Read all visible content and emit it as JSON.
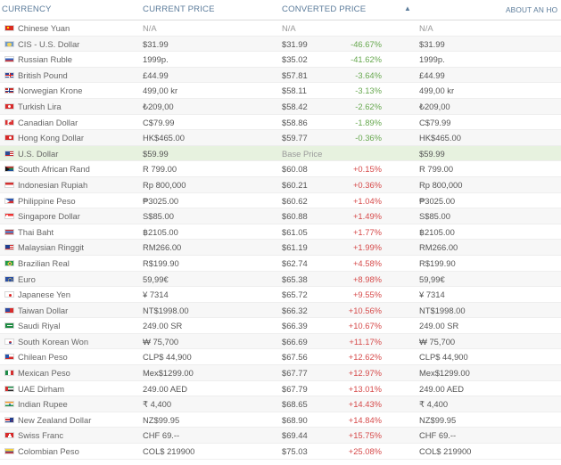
{
  "table": {
    "headers": {
      "currency": "CURRENCY",
      "current_price": "CURRENT PRICE",
      "converted_price": "CONVERTED PRICE",
      "sort_icon": "▲",
      "about": "ABOUT AN HO"
    },
    "rows": [
      {
        "flag_icon": "china-flag-icon",
        "name": "Chinese Yuan",
        "current": "N/A",
        "converted": "N/A",
        "change": "",
        "last": "N/A",
        "change_type": "neutral"
      },
      {
        "flag_icon": "cis-flag-icon",
        "name": "CIS - U.S. Dollar",
        "current": "$31.99",
        "converted": "$31.99",
        "change": "-46.67%",
        "last": "$31.99",
        "change_type": "down"
      },
      {
        "flag_icon": "russia-flag-icon",
        "name": "Russian Ruble",
        "current": "1999p.",
        "converted": "$35.02",
        "change": "-41.62%",
        "last": "1999p.",
        "change_type": "down"
      },
      {
        "flag_icon": "uk-flag-icon",
        "name": "British Pound",
        "current": "£44.99",
        "converted": "$57.81",
        "change": "-3.64%",
        "last": "£44.99",
        "change_type": "down"
      },
      {
        "flag_icon": "norway-flag-icon",
        "name": "Norwegian Krone",
        "current": "499,00 kr",
        "converted": "$58.11",
        "change": "-3.13%",
        "last": "499,00 kr",
        "change_type": "down"
      },
      {
        "flag_icon": "turkey-flag-icon",
        "name": "Turkish Lira",
        "current": "₺209,00",
        "converted": "$58.42",
        "change": "-2.62%",
        "last": "₺209,00",
        "change_type": "down"
      },
      {
        "flag_icon": "canada-flag-icon",
        "name": "Canadian Dollar",
        "current": "C$79.99",
        "converted": "$58.86",
        "change": "-1.89%",
        "last": "C$79.99",
        "change_type": "down"
      },
      {
        "flag_icon": "hong-kong-flag-icon",
        "name": "Hong Kong Dollar",
        "current": "HK$465.00",
        "converted": "$59.77",
        "change": "-0.36%",
        "last": "HK$465.00",
        "change_type": "down"
      },
      {
        "flag_icon": "usa-flag-icon",
        "name": "U.S. Dollar",
        "current": "$59.99",
        "converted": "Base Price",
        "change": "",
        "last": "$59.99",
        "change_type": "neutral"
      },
      {
        "flag_icon": "south-africa-flag-icon",
        "name": "South African Rand",
        "current": "R 799.00",
        "converted": "$60.08",
        "change": "+0.15%",
        "last": "R 799.00",
        "change_type": "up"
      },
      {
        "flag_icon": "indonesia-flag-icon",
        "name": "Indonesian Rupiah",
        "current": "Rp 800,000",
        "converted": "$60.21",
        "change": "+0.36%",
        "last": "Rp 800,000",
        "change_type": "up"
      },
      {
        "flag_icon": "philippines-flag-icon",
        "name": "Philippine Peso",
        "current": "₱3025.00",
        "converted": "$60.62",
        "change": "+1.04%",
        "last": "₱3025.00",
        "change_type": "up"
      },
      {
        "flag_icon": "singapore-flag-icon",
        "name": "Singapore Dollar",
        "current": "S$85.00",
        "converted": "$60.88",
        "change": "+1.49%",
        "last": "S$85.00",
        "change_type": "up"
      },
      {
        "flag_icon": "thailand-flag-icon",
        "name": "Thai Baht",
        "current": "฿2105.00",
        "converted": "$61.05",
        "change": "+1.77%",
        "last": "฿2105.00",
        "change_type": "up"
      },
      {
        "flag_icon": "malaysia-flag-icon",
        "name": "Malaysian Ringgit",
        "current": "RM266.00",
        "converted": "$61.19",
        "change": "+1.99%",
        "last": "RM266.00",
        "change_type": "up"
      },
      {
        "flag_icon": "brazil-flag-icon",
        "name": "Brazilian Real",
        "current": "R$199.90",
        "converted": "$62.74",
        "change": "+4.58%",
        "last": "R$199.90",
        "change_type": "up"
      },
      {
        "flag_icon": "eu-flag-icon",
        "name": "Euro",
        "current": "59,99€",
        "converted": "$65.38",
        "change": "+8.98%",
        "last": "59,99€",
        "change_type": "up"
      },
      {
        "flag_icon": "japan-flag-icon",
        "name": "Japanese Yen",
        "current": "¥ 7314",
        "converted": "$65.72",
        "change": "+9.55%",
        "last": "¥ 7314",
        "change_type": "up"
      },
      {
        "flag_icon": "taiwan-flag-icon",
        "name": "Taiwan Dollar",
        "current": "NT$1998.00",
        "converted": "$66.32",
        "change": "+10.56%",
        "last": "NT$1998.00",
        "change_type": "up"
      },
      {
        "flag_icon": "saudi-arabia-flag-icon",
        "name": "Saudi Riyal",
        "current": "249.00 SR",
        "converted": "$66.39",
        "change": "+10.67%",
        "last": "249.00 SR",
        "change_type": "up"
      },
      {
        "flag_icon": "south-korea-flag-icon",
        "name": "South Korean Won",
        "current": "₩ 75,700",
        "converted": "$66.69",
        "change": "+11.17%",
        "last": "₩ 75,700",
        "change_type": "up"
      },
      {
        "flag_icon": "chile-flag-icon",
        "name": "Chilean Peso",
        "current": "CLP$ 44,900",
        "converted": "$67.56",
        "change": "+12.62%",
        "last": "CLP$ 44,900",
        "change_type": "up"
      },
      {
        "flag_icon": "mexico-flag-icon",
        "name": "Mexican Peso",
        "current": "Mex$1299.00",
        "converted": "$67.77",
        "change": "+12.97%",
        "last": "Mex$1299.00",
        "change_type": "up"
      },
      {
        "flag_icon": "uae-flag-icon",
        "name": "UAE Dirham",
        "current": "249.00 AED",
        "converted": "$67.79",
        "change": "+13.01%",
        "last": "249.00 AED",
        "change_type": "up"
      },
      {
        "flag_icon": "india-flag-icon",
        "name": "Indian Rupee",
        "current": "₹ 4,400",
        "converted": "$68.65",
        "change": "+14.43%",
        "last": "₹ 4,400",
        "change_type": "up"
      },
      {
        "flag_icon": "new-zealand-flag-icon",
        "name": "New Zealand Dollar",
        "current": "NZ$99.95",
        "converted": "$68.90",
        "change": "+14.84%",
        "last": "NZ$99.95",
        "change_type": "up"
      },
      {
        "flag_icon": "switzerland-flag-icon",
        "name": "Swiss Franc",
        "current": "CHF 69.--",
        "converted": "$69.44",
        "change": "+15.75%",
        "last": "CHF 69.--",
        "change_type": "up"
      },
      {
        "flag_icon": "colombia-flag-icon",
        "name": "Colombian Peso",
        "current": "COL$ 219900",
        "converted": "$75.03",
        "change": "+25.08%",
        "last": "COL$ 219900",
        "change_type": "up"
      }
    ]
  },
  "colors": {
    "header_text": "#5c7c9b",
    "row_alt": "#f7f7f7",
    "base_row": "#e7f2df",
    "positive": "#d64a4a",
    "negative": "#67a84f",
    "border": "#eeeeee"
  }
}
